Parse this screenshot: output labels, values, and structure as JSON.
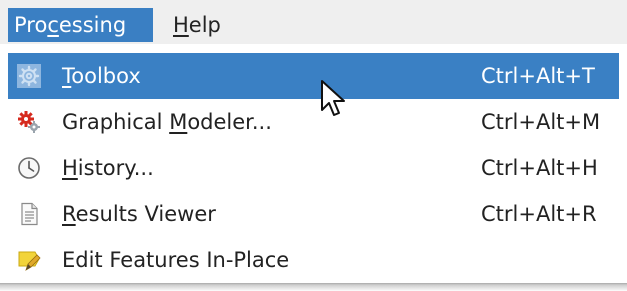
{
  "menubar": {
    "items": [
      {
        "pre": "Pro",
        "mnemonic": "c",
        "post": "essing",
        "active": true
      },
      {
        "pre": "",
        "mnemonic": "H",
        "post": "elp",
        "active": false
      }
    ]
  },
  "menu": {
    "items": [
      {
        "pre": "",
        "mnemonic": "T",
        "post": "oolbox",
        "shortcut": "Ctrl+Alt+T",
        "icon": "toolbox-icon",
        "selected": true
      },
      {
        "pre": "Graphical ",
        "mnemonic": "M",
        "post": "odeler...",
        "shortcut": "Ctrl+Alt+M",
        "icon": "graphical-modeler-icon",
        "selected": false
      },
      {
        "pre": "",
        "mnemonic": "H",
        "post": "istory...",
        "shortcut": "Ctrl+Alt+H",
        "icon": "history-clock-icon",
        "selected": false
      },
      {
        "pre": "",
        "mnemonic": "R",
        "post": "esults Viewer",
        "shortcut": "Ctrl+Alt+R",
        "icon": "results-viewer-icon",
        "selected": false
      },
      {
        "label": "Edit Features In-Place",
        "icon": "edit-in-place-icon",
        "selected": false
      }
    ]
  },
  "colors": {
    "highlight": "#3a80c4",
    "menubar_bg": "#efefef",
    "menu_bg": "#ffffff"
  }
}
